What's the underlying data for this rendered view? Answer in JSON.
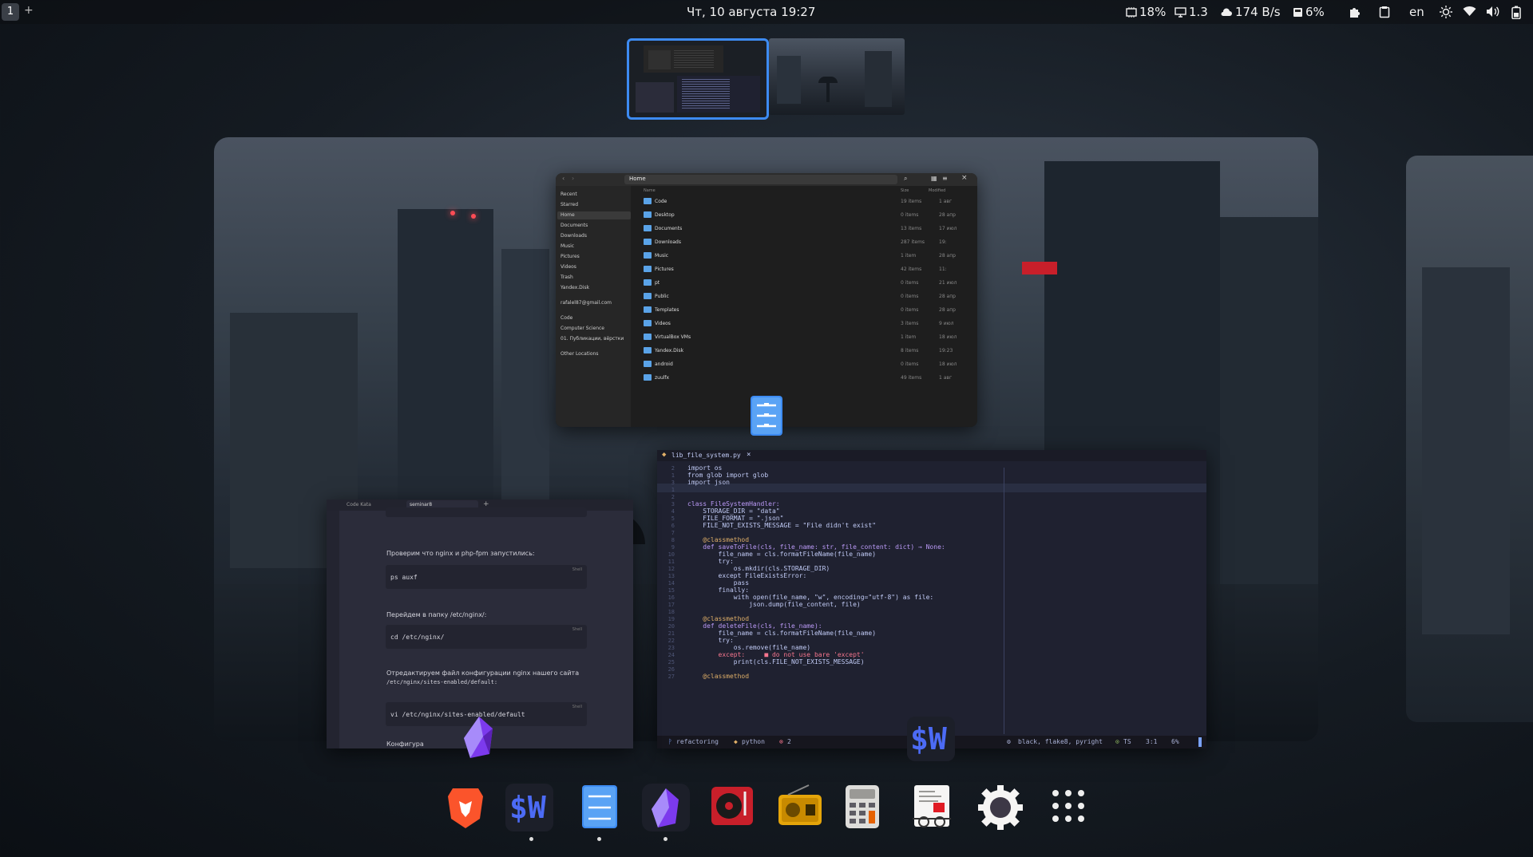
{
  "topbar": {
    "workspace_number": "1",
    "add_workspace": "+",
    "clock": "Чт, 10 августа  19:27",
    "cpu": "18%",
    "load": "1.3",
    "net": "174 B/s",
    "disk": "6%",
    "keyboard_layout": "en"
  },
  "files_window": {
    "path": "Home",
    "sidebar": [
      "Recent",
      "Starred",
      "Home",
      "Documents",
      "Downloads",
      "Music",
      "Pictures",
      "Videos",
      "Trash",
      "Yandex.Disk",
      "rafalel87@gmail.com",
      "Code",
      "Computer Science",
      "01. Публикации, вёрстки",
      "Other Locations"
    ],
    "columns": [
      "Name",
      "Size",
      "Modified"
    ],
    "rows": [
      {
        "name": "Code",
        "size": "19 items",
        "modified": "1 авг"
      },
      {
        "name": "Desktop",
        "size": "0 items",
        "modified": "28 апр"
      },
      {
        "name": "Documents",
        "size": "13 items",
        "modified": "17 июл"
      },
      {
        "name": "Downloads",
        "size": "287 items",
        "modified": "19:"
      },
      {
        "name": "Music",
        "size": "1 item",
        "modified": "28 апр"
      },
      {
        "name": "Pictures",
        "size": "42 items",
        "modified": "11:"
      },
      {
        "name": "pt",
        "size": "0 items",
        "modified": "21 июл"
      },
      {
        "name": "Public",
        "size": "0 items",
        "modified": "28 апр"
      },
      {
        "name": "Templates",
        "size": "0 items",
        "modified": "28 апр"
      },
      {
        "name": "Videos",
        "size": "3 items",
        "modified": "9 июл"
      },
      {
        "name": "VirtualBox VMs",
        "size": "1 item",
        "modified": "18 июл"
      },
      {
        "name": "Yandex.Disk",
        "size": "8 items",
        "modified": "19:23"
      },
      {
        "name": "android",
        "size": "0 items",
        "modified": "18 июл"
      },
      {
        "name": "zuulfx",
        "size": "49 items",
        "modified": "1 авг"
      }
    ]
  },
  "editor_window": {
    "tab": "lib_file_system.py",
    "lines": [
      {
        "n": "2",
        "code": "import os"
      },
      {
        "n": "1",
        "code": "from glob import glob"
      },
      {
        "n": "3",
        "code": "import json"
      },
      {
        "n": "1",
        "code": ""
      },
      {
        "n": "2",
        "code": ""
      },
      {
        "n": "3",
        "code": "class FileSystemHandler:"
      },
      {
        "n": "4",
        "code": "    STORAGE_DIR = \"data\""
      },
      {
        "n": "5",
        "code": "    FILE_FORMAT = \".json\""
      },
      {
        "n": "6",
        "code": "    FILE_NOT_EXISTS_MESSAGE = \"File didn't exist\""
      },
      {
        "n": "7",
        "code": ""
      },
      {
        "n": "8",
        "code": "    @classmethod"
      },
      {
        "n": "9",
        "code": "    def saveToFile(cls, file_name: str, file_content: dict) → None:"
      },
      {
        "n": "10",
        "code": "        file_name = cls.formatFileName(file_name)"
      },
      {
        "n": "11",
        "code": "        try:"
      },
      {
        "n": "12",
        "code": "            os.mkdir(cls.STORAGE_DIR)"
      },
      {
        "n": "13",
        "code": "        except FileExistsError:"
      },
      {
        "n": "14",
        "code": "            pass"
      },
      {
        "n": "15",
        "code": "        finally:"
      },
      {
        "n": "16",
        "code": "            with open(file_name, \"w\", encoding=\"utf-8\") as file:"
      },
      {
        "n": "17",
        "code": "                json.dump(file_content, file)"
      },
      {
        "n": "18",
        "code": ""
      },
      {
        "n": "19",
        "code": "    @classmethod"
      },
      {
        "n": "20",
        "code": "    def deleteFile(cls, file_name):"
      },
      {
        "n": "21",
        "code": "        file_name = cls.formatFileName(file_name)"
      },
      {
        "n": "22",
        "code": "        try:"
      },
      {
        "n": "23",
        "code": "            os.remove(file_name)"
      },
      {
        "n": "24",
        "code": "        except:     ■ do not use bare 'except'"
      },
      {
        "n": "25",
        "code": "            print(cls.FILE_NOT_EXISTS_MESSAGE)"
      },
      {
        "n": "26",
        "code": ""
      },
      {
        "n": "27",
        "code": "    @classmethod"
      }
    ],
    "status": {
      "branch": "refactoring",
      "lang": "python",
      "errors": "2",
      "lsp": "black, flake8, pyright",
      "ts": "TS",
      "pos": "3:1",
      "pct": "6%"
    }
  },
  "notes_window": {
    "tab1": "Code Kata",
    "tab2": "seminar8",
    "code_snippet_label": "Shell",
    "text1": "Проверим что nginx и php-fpm запустились:",
    "code1": "ps auxf",
    "text2": "Перейдем в папку /etc/nginx/:",
    "code2": "cd /etc/nginx/",
    "text3": "Отредактируем файл конфигурации nginx нашего сайта",
    "text3b": "/etc/nginx/sites-enabled/default:",
    "code3": "vi /etc/nginx/sites-enabled/default",
    "text4": "Конфигура"
  },
  "dock": [
    "Brave",
    "Warp",
    "Files",
    "Obsidian",
    "Music",
    "Radio",
    "Calculator",
    "Document Viewer",
    "Settings",
    "Show Apps"
  ],
  "accent_color": "#3d8bf2"
}
